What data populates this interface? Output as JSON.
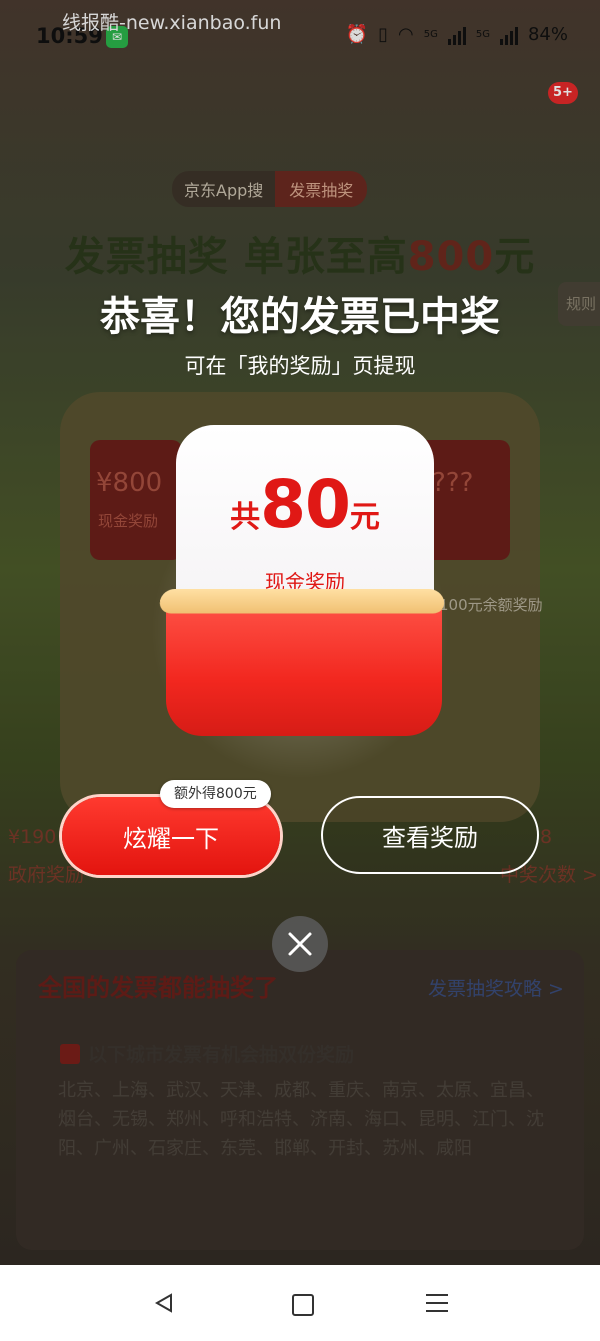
{
  "status_bar": {
    "time": "10:59",
    "watermark": "线报酷-new.xianbao.fun",
    "battery": "84%",
    "network_1": "5G",
    "network_2": "5G"
  },
  "notification_badge": "5+",
  "background_page": {
    "brand_left": "京东App搜",
    "brand_right": "发票抽奖",
    "headline_prefix": "发票抽奖 单张至高",
    "headline_amount": "800",
    "headline_suffix": "元",
    "rules_tab": "规则",
    "slot_left": "¥800",
    "slot_right": "???",
    "slot_left_label": "现金奖励",
    "side_note": "中100元余额奖励",
    "left_stat_value": "¥190",
    "left_stat_label": "政府奖励",
    "right_stat_value": "8",
    "right_stat_label": "中奖次数 >",
    "panel_title": "全国的发票都能抽奖了",
    "panel_link": "发票抽奖攻略 >",
    "panel_subtitle": "以下城市发票有机会抽双份奖励",
    "panel_cities": "北京、上海、武汉、天津、成都、重庆、南京、太原、宜昌、烟台、无锡、郑州、呼和浩特、济南、海口、昆明、江门、沈阳、广州、石家庄、东莞、邯郸、开封、苏州、咸阳"
  },
  "modal": {
    "title": "恭喜！您的发票已中奖",
    "subtitle": "可在「我的奖励」页提现",
    "amount_prefix": "共",
    "amount": "80",
    "amount_suffix": "元",
    "reward_label": "现金奖励",
    "bubble_text": "额外得800元",
    "show_off_label": "炫耀一下",
    "view_reward_label": "查看奖励",
    "close_icon": "close-icon"
  },
  "colors": {
    "accent_red": "#e01815",
    "button_red": "#ff3a2f",
    "lip_gold": "#f0c072"
  }
}
